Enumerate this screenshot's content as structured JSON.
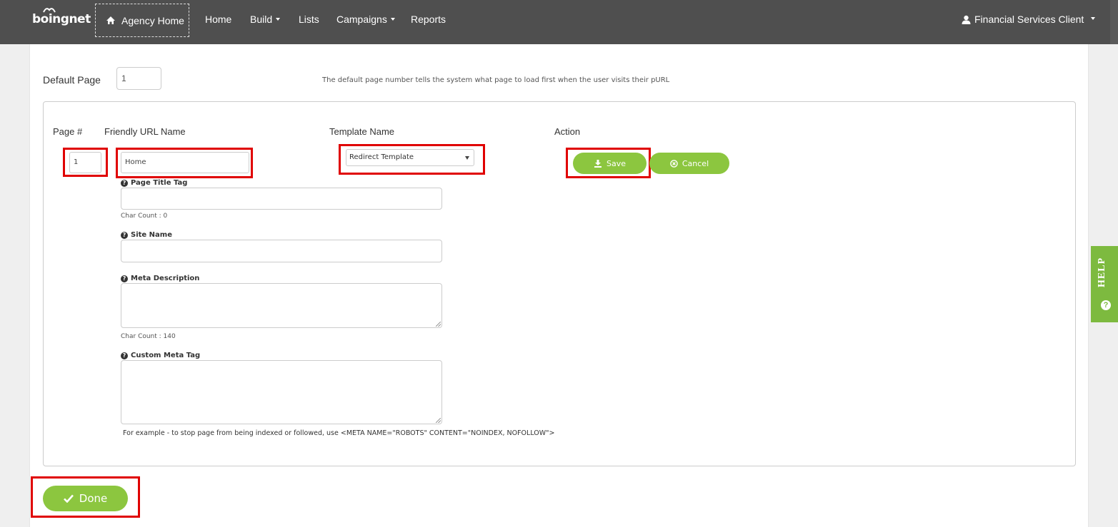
{
  "nav": {
    "logo_text": "boingnet",
    "agency_home": "Agency Home",
    "items": [
      {
        "label": "Home"
      },
      {
        "label": "Build"
      },
      {
        "label": "Lists"
      },
      {
        "label": "Campaigns"
      },
      {
        "label": "Reports"
      }
    ],
    "user": "Financial Services Client"
  },
  "settings": {
    "default_page_label": "Default Page",
    "default_page_value": "1",
    "hint": "The default page number tells the system what page to load first when the user visits their pURL"
  },
  "table": {
    "headers": {
      "page_num": "Page #",
      "friendly_url": "Friendly URL Name",
      "template": "Template Name",
      "action": "Action"
    },
    "row": {
      "page_num": "1",
      "friendly_url": "Home",
      "template": "Redirect Template"
    },
    "save_label": "Save",
    "cancel_label": "Cancel"
  },
  "fields": {
    "page_title_label": "Page Title Tag",
    "page_title_count": "Char Count : 0",
    "site_name_label": "Site Name",
    "meta_desc_label": "Meta Description",
    "meta_desc_count": "Char Count : 140",
    "custom_meta_label": "Custom Meta Tag",
    "example": "For example - to stop page from being indexed or followed, use <META NAME=\"ROBOTS\" CONTENT=\"NOINDEX, NOFOLLOW\">"
  },
  "footer": {
    "done_label": "Done"
  },
  "help": {
    "label": "HELP"
  },
  "colors": {
    "nav_bg": "#4f4f4f",
    "accent_green": "#8cc63f",
    "highlight_red": "#e00000"
  }
}
